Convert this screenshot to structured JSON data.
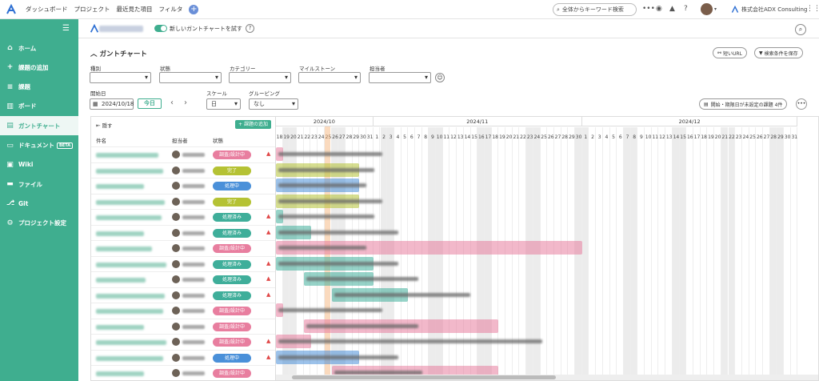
{
  "topbar": {
    "nav": [
      "ダッシュボード",
      "プロジェクト",
      "最近見た項目",
      "フィルタ"
    ],
    "search_placeholder": "全体からキーワード検索",
    "company": "株式会社ADX Consulting",
    "add_icon": "plus-icon"
  },
  "sidebar": {
    "items": [
      {
        "label": "ホーム",
        "icon": "home-icon",
        "glyph": "⌂"
      },
      {
        "label": "課題の追加",
        "icon": "plus-icon",
        "glyph": "+"
      },
      {
        "label": "課題",
        "icon": "list-icon",
        "glyph": "≡"
      },
      {
        "label": "ボード",
        "icon": "board-icon",
        "glyph": "▥"
      },
      {
        "label": "ガントチャート",
        "icon": "gantt-icon",
        "glyph": "▤",
        "active": true
      },
      {
        "label": "ドキュメント",
        "icon": "document-icon",
        "glyph": "▭",
        "badge": "BETA"
      },
      {
        "label": "Wiki",
        "icon": "wiki-icon",
        "glyph": "▣"
      },
      {
        "label": "ファイル",
        "icon": "folder-icon",
        "glyph": "▬"
      },
      {
        "label": "Git",
        "icon": "git-icon",
        "glyph": "⎇"
      },
      {
        "label": "プロジェクト設定",
        "icon": "settings-icon",
        "glyph": "⚙"
      }
    ]
  },
  "subheader": {
    "toggle_label": "新しいガントチャートを試す",
    "help": "?"
  },
  "main": {
    "title": "ガントチャート",
    "short_url": "短いURL",
    "save_filter": "検索条件を保存",
    "filters": {
      "type": "種別",
      "status": "状態",
      "category": "カテゴリー",
      "milestone": "マイルストーン",
      "assignee": "担当者"
    },
    "start_label": "開始日",
    "start_value": "2024/10/18",
    "today": "今日",
    "scale_label": "スケール",
    "scale_value": "日",
    "grouping_label": "グルーピング",
    "grouping_value": "なし",
    "unset_btn": "開始・期限日が未設定の課題 4件"
  },
  "list": {
    "hide": "隠す",
    "add": "課題の追加",
    "col_subject": "件名",
    "col_assignee": "担当者",
    "col_status": "状態"
  },
  "status_colors": {
    "調査/設計中": "#e87e9f",
    "完了": "#b5c234",
    "処理中": "#4a90d9",
    "処理済み": "#3fae9a"
  },
  "rows": [
    {
      "status": "調査/設計中",
      "fire": true
    },
    {
      "status": "完了",
      "fire": false
    },
    {
      "status": "処理中",
      "fire": false
    },
    {
      "status": "完了",
      "fire": false
    },
    {
      "status": "処理済み",
      "fire": true
    },
    {
      "status": "処理済み",
      "fire": true
    },
    {
      "status": "調査/設計中",
      "fire": false
    },
    {
      "status": "処理済み",
      "fire": true
    },
    {
      "status": "処理済み",
      "fire": true
    },
    {
      "status": "処理済み",
      "fire": true
    },
    {
      "status": "調査/設計中",
      "fire": false
    },
    {
      "status": "調査/設計中",
      "fire": false
    },
    {
      "status": "調査/設計中",
      "fire": true
    },
    {
      "status": "処理中",
      "fire": true
    },
    {
      "status": "調査/設計中",
      "fire": false
    }
  ],
  "chart_data": {
    "type": "gantt",
    "months": [
      "2024/10",
      "2024/11",
      "2024/12"
    ],
    "start": "2024/10/18",
    "end": "2024/12/31",
    "today": "2024/10/25",
    "tasks": [
      {
        "start": "2024/10/18",
        "end": "2024/10/18",
        "color": "#e87e9f"
      },
      {
        "start": "2024/10/18",
        "end": "2024/10/29",
        "color": "#b5c234"
      },
      {
        "start": "2024/10/18",
        "end": "2024/10/29",
        "color": "#4a90d9"
      },
      {
        "start": "2024/10/18",
        "end": "2024/10/29",
        "color": "#b5c234"
      },
      {
        "start": "2024/10/18",
        "end": "2024/10/18",
        "color": "#3fae9a"
      },
      {
        "start": "2024/10/18",
        "end": "2024/10/22",
        "color": "#3fae9a"
      },
      {
        "start": "2024/10/18",
        "end": "2024/11/30",
        "color": "#e87e9f"
      },
      {
        "start": "2024/10/18",
        "end": "2024/10/31",
        "color": "#3fae9a"
      },
      {
        "start": "2024/10/22",
        "end": "2024/10/31",
        "color": "#3fae9a"
      },
      {
        "start": "2024/10/26",
        "end": "2024/11/05",
        "color": "#3fae9a"
      },
      {
        "start": "2024/10/18",
        "end": "2024/10/18",
        "color": "#e87e9f"
      },
      {
        "start": "2024/10/22",
        "end": "2024/11/18",
        "color": "#e87e9f"
      },
      {
        "start": "2024/10/18",
        "end": "2024/10/22",
        "color": "#e87e9f"
      },
      {
        "start": "2024/10/18",
        "end": "2024/10/29",
        "color": "#4a90d9"
      },
      {
        "start": "2024/10/26",
        "end": "2024/11/18",
        "color": "#e87e9f"
      }
    ]
  }
}
